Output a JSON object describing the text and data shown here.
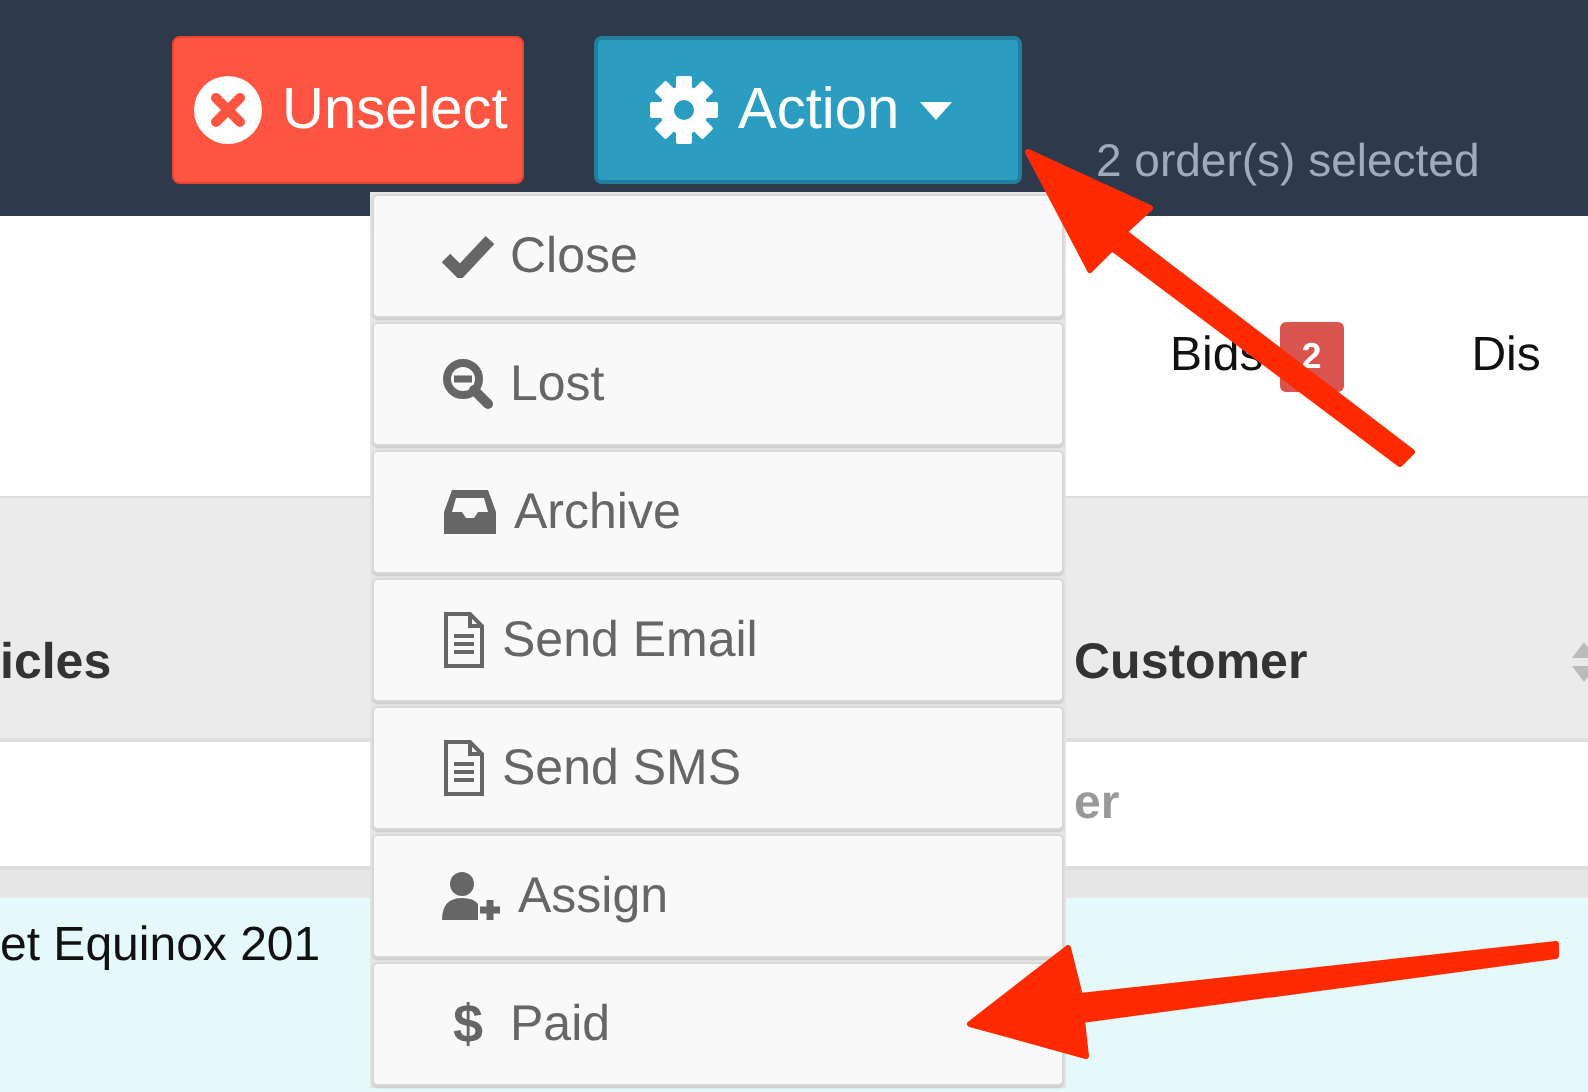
{
  "toolbar": {
    "buttons": [
      {
        "kind": "unselect",
        "label": "Unselect"
      },
      {
        "kind": "action",
        "label": "Action"
      }
    ],
    "selection_count": "2 order(s) selected"
  },
  "tabs": [
    {
      "label": "Bids",
      "badge": "2"
    },
    {
      "label": "Dis"
    }
  ],
  "table": {
    "columns": [
      {
        "label": "icles"
      },
      {
        "label": "Customer"
      }
    ],
    "filters": [
      {
        "placeholder": "er"
      }
    ],
    "rows": [
      {
        "cells": [
          "et Equinox 201"
        ],
        "selected": true
      }
    ]
  },
  "dropdown": {
    "items": [
      {
        "kind": "check",
        "label": "Close"
      },
      {
        "kind": "lost",
        "label": "Lost"
      },
      {
        "kind": "inbox",
        "label": "Archive"
      },
      {
        "kind": "file",
        "label": "Send Email"
      },
      {
        "kind": "file",
        "label": "Send SMS"
      },
      {
        "kind": "user-plus",
        "label": "Assign"
      },
      {
        "kind": "text",
        "icon": "$",
        "label": "Paid"
      }
    ]
  }
}
